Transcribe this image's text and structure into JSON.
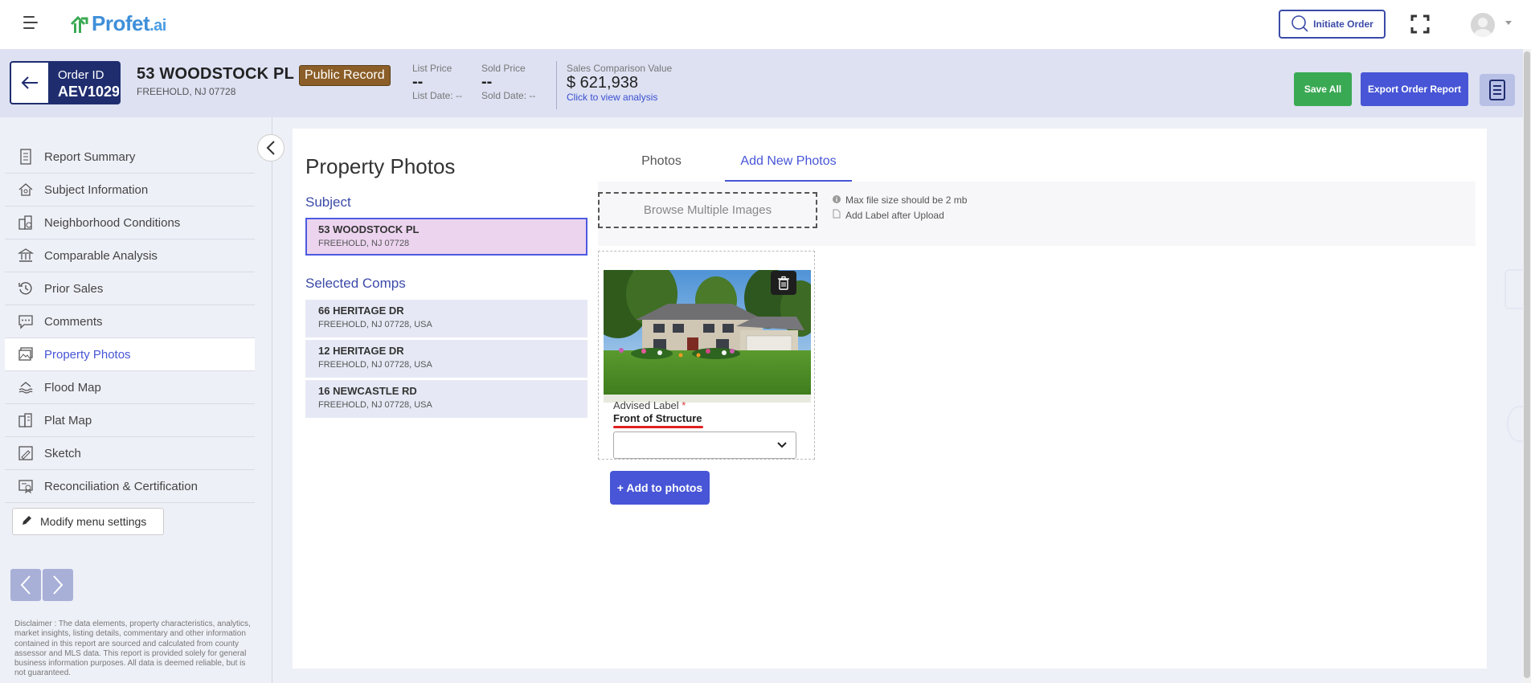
{
  "topbar": {
    "logo_text": "Profet",
    "logo_suffix": ".ai",
    "initiate_order_label": "Initiate Order"
  },
  "header": {
    "order_label": "Order ID",
    "order_id": "AEV1029",
    "address_line1": "53 WOODSTOCK PL",
    "address_line2": "FREEHOLD, NJ 07728",
    "record_badge": "Public Record",
    "list_price_label": "List Price",
    "list_price_value": "--",
    "list_date": "List Date: --",
    "sold_price_label": "Sold Price",
    "sold_price_value": "--",
    "sold_date": "Sold Date: --",
    "scv_label": "Sales Comparison Value",
    "scv_value": "$ 621,938",
    "scv_link": "Click to view analysis",
    "save_all_label": "Save All",
    "export_label": "Export Order Report"
  },
  "sidebar": {
    "items": [
      {
        "label": "Report Summary",
        "icon": "report-icon"
      },
      {
        "label": "Subject Information",
        "icon": "house-icon"
      },
      {
        "label": "Neighborhood Conditions",
        "icon": "neighborhood-icon"
      },
      {
        "label": "Comparable Analysis",
        "icon": "bank-icon"
      },
      {
        "label": "Prior Sales",
        "icon": "history-icon"
      },
      {
        "label": "Comments",
        "icon": "comment-icon"
      },
      {
        "label": "Property Photos",
        "icon": "photo-icon"
      },
      {
        "label": "Flood Map",
        "icon": "flood-icon"
      },
      {
        "label": "Plat Map",
        "icon": "plat-icon"
      },
      {
        "label": "Sketch",
        "icon": "sketch-icon"
      },
      {
        "label": "Reconciliation & Certification",
        "icon": "certificate-icon"
      }
    ],
    "active_index": 6,
    "modify_label": "Modify menu settings",
    "disclaimer": "Disclaimer : The data elements, property characteristics, analytics, market insights, listing details, commentary and other information contained in this report are sourced and calculated from county assessor and MLS data. This report is provided solely for general business information purposes. All data is deemed reliable, but is not guaranteed."
  },
  "main": {
    "title": "Property Photos",
    "subject_heading": "Subject",
    "subject": {
      "title": "53 WOODSTOCK PL",
      "sub": "FREEHOLD, NJ 07728"
    },
    "comps_heading": "Selected Comps",
    "comps": [
      {
        "title": "66 HERITAGE DR",
        "sub": "FREEHOLD, NJ 07728, USA"
      },
      {
        "title": "12 HERITAGE DR",
        "sub": "FREEHOLD, NJ 07728, USA"
      },
      {
        "title": "16 NEWCASTLE RD",
        "sub": "FREEHOLD, NJ 07728, USA"
      }
    ],
    "tabs": [
      "Photos",
      "Add New Photos"
    ],
    "active_tab": 1,
    "browse_label": "Browse Multiple Images",
    "hint_size": "Max file size should be 2 mb",
    "hint_label": "Add Label after Upload",
    "advised_label": "Advised Label",
    "required_mark": "*",
    "advised_value": "Front of Structure",
    "add_photos_label": "+ Add to photos"
  },
  "colors": {
    "accent": "#4755d6",
    "navy": "#1f2d6f",
    "save_green": "#3aa953",
    "badge_brown": "#8b5e28",
    "header_band": "#dde1f2",
    "subject_bg": "#ecd4ef"
  }
}
